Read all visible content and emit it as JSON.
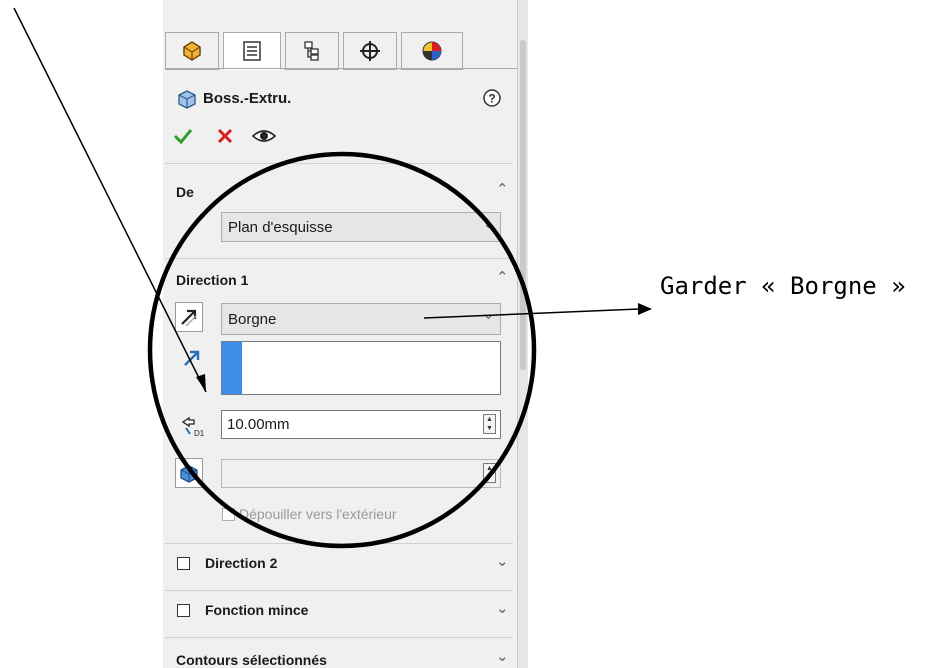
{
  "panel": {
    "title": "Boss.-Extru.",
    "help_icon": "help-circle-icon",
    "actions": [
      "ok-check-icon",
      "cancel-x-icon",
      "preview-eye-icon"
    ],
    "tabs": [
      "feature-manager-icon",
      "property-manager-icon",
      "configuration-manager-icon",
      "dimxpert-icon",
      "display-manager-icon"
    ]
  },
  "sections": {
    "de": {
      "label": "De",
      "value": "Plan d'esquisse"
    },
    "direction1": {
      "label": "Direction 1",
      "end_condition": "Borgne",
      "depth": "10.00mm",
      "draft_label": "Dépouiller vers l'extérieur"
    },
    "direction2": {
      "label": "Direction 2"
    },
    "thin": {
      "label": "Fonction mince"
    },
    "contours": {
      "label": "Contours sélectionnés"
    }
  },
  "annotation": {
    "text": "Garder « Borgne »"
  },
  "colors": {
    "ok": "#2f9e2f",
    "cancel": "#d42020",
    "selection_accent": "#3d8ee8",
    "annotation_ink": "#000000"
  }
}
